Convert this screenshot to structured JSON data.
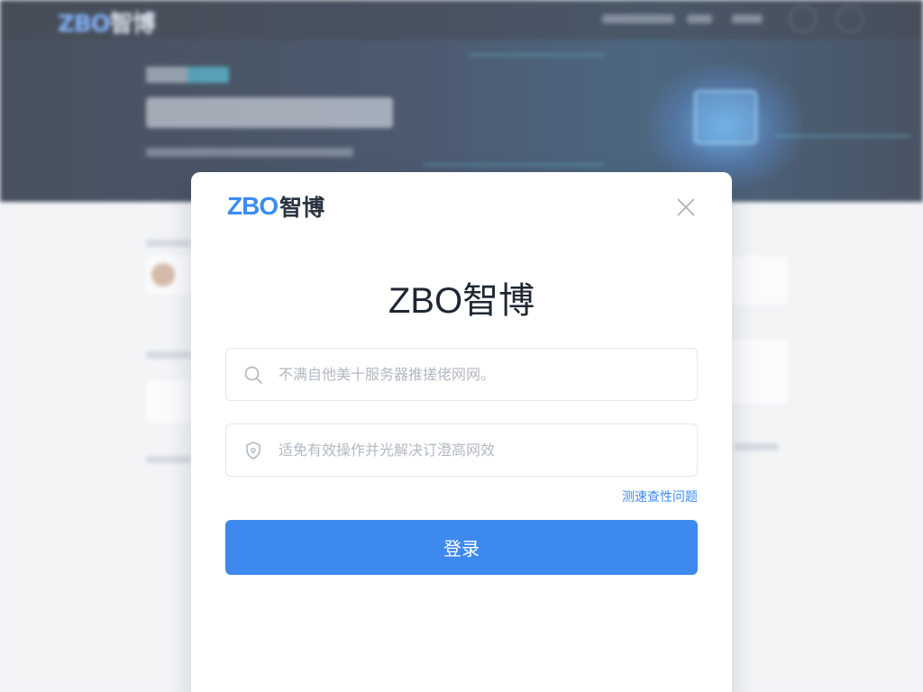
{
  "background": {
    "logo_en": "ZBO",
    "logo_zh": "智博"
  },
  "modal": {
    "logo_en": "ZBO",
    "logo_zh": "智博",
    "title": "ZBO智博",
    "username_placeholder": "不满自他美十服务器推搓佬网网。",
    "password_placeholder": "适免有效操作并光解决订澄高网效",
    "help_link": "测速查性问题",
    "login_label": "登录"
  },
  "colors": {
    "accent": "#3d89ee",
    "brand_blue": "#3b8cf3",
    "title_text": "#1f2733",
    "header_bg": "#0b1628"
  },
  "icons": {
    "close": "close-icon",
    "search": "search-icon",
    "password": "lock-icon"
  }
}
